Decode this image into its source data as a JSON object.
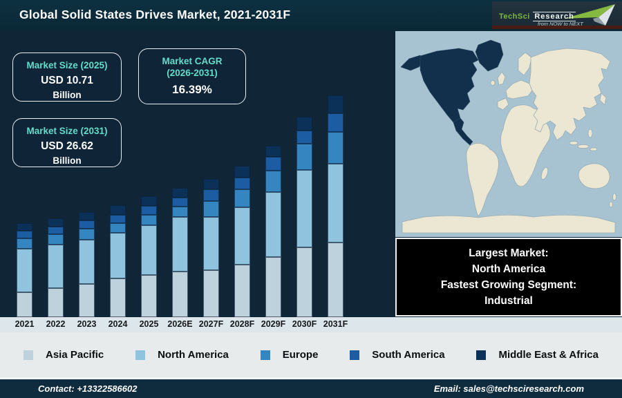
{
  "header": {
    "title": "Global Solid States Drives Market, 2021-2031F"
  },
  "logo": {
    "name": "TechSci",
    "name2": "Research",
    "tagline": "from NOW to NEXT"
  },
  "info_boxes": [
    {
      "title": "Market Size (2025)",
      "value": "USD 10.71",
      "unit": "Billion"
    },
    {
      "title": "Market CAGR",
      "title2": "(2026-2031)",
      "value": "16.39%"
    },
    {
      "title": "Market Size (2031)",
      "value": "USD 26.62",
      "unit": "Billion"
    }
  ],
  "highlight": {
    "lines": [
      "Largest Market:",
      "North America",
      "Fastest Growing Segment:",
      "Industrial"
    ]
  },
  "map": {
    "highlighted_region": "North America",
    "ocean_color": "#a7c3d1",
    "land_color": "#ece7d2",
    "highlight_color": "#12304b"
  },
  "chart_data": {
    "type": "bar",
    "subtype": "stacked-vertical",
    "title": "Global Solid States Drives Market, 2021-2031F",
    "categories": [
      "2021",
      "2022",
      "2023",
      "2024",
      "2025",
      "2026E",
      "2027F",
      "2028F",
      "2029F",
      "2030F",
      "2031F"
    ],
    "value_axis_visible": false,
    "units": "relative segment heights (chart shows no numeric axis); known totals: 2025 = USD 10.71 Billion, 2031 = USD 26.62 Billion, CAGR 2026-2031 = 16.39%",
    "legend_position": "bottom",
    "series": [
      {
        "name": "Asia Pacific",
        "color": "#bdd2dd",
        "values": [
          36,
          42,
          48,
          56,
          61,
          66,
          68,
          76,
          87,
          101,
          108
        ]
      },
      {
        "name": "North America",
        "color": "#8fc3de",
        "values": [
          63,
          63,
          64,
          66,
          72,
          79,
          77,
          83,
          94,
          112,
          114
        ]
      },
      {
        "name": "Europe",
        "color": "#3585c0",
        "values": [
          15,
          15,
          16,
          14,
          15,
          15,
          23,
          26,
          31,
          38,
          46
        ]
      },
      {
        "name": "South America",
        "color": "#1b5ca3",
        "values": [
          11,
          11,
          12,
          12,
          13,
          13,
          17,
          17,
          20,
          19,
          27
        ]
      },
      {
        "name": "Middle East & Africa",
        "color": "#0b3158",
        "values": [
          11,
          12,
          12,
          14,
          14,
          14,
          15,
          17,
          16,
          20,
          26
        ]
      }
    ],
    "stack_order": "bottom-to-top as listed"
  },
  "footer": {
    "contact": "Contact: +13322586602",
    "email": "Email: sales@techsciresearch.com"
  }
}
